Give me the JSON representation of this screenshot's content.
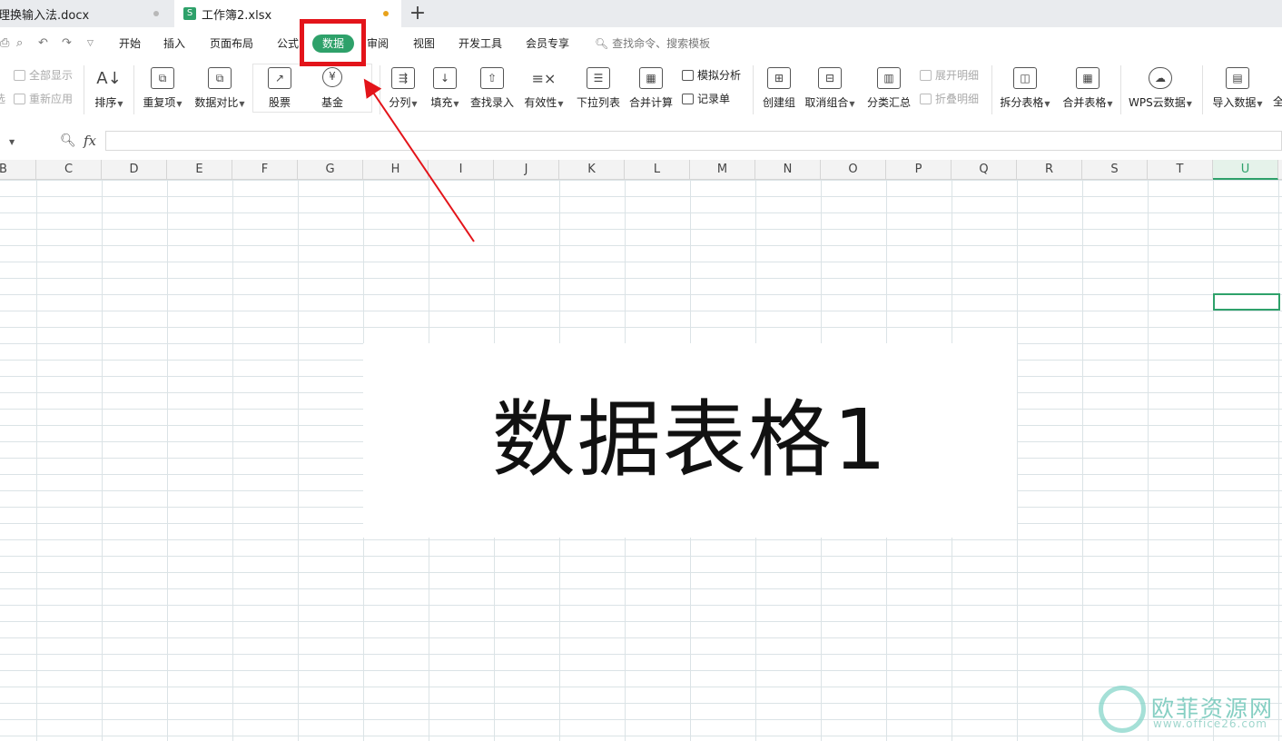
{
  "tabs": [
    {
      "title": "理换输入法.docx"
    },
    {
      "title": "工作簿2.xlsx",
      "logo": "S"
    }
  ],
  "new_tab": "+",
  "menu": {
    "items": [
      "开始",
      "插入",
      "页面布局",
      "公式",
      "数据",
      "审阅",
      "视图",
      "开发工具",
      "会员专享"
    ],
    "active": "数据",
    "search": "查找命令、搜索模板"
  },
  "ribbon": {
    "show_all": "全部显示",
    "reapply": "重新应用",
    "filter_cut": "选",
    "sort": "排序",
    "duplicates": "重复项",
    "compare": "数据对比",
    "stock": "股票",
    "fund": "基金",
    "fund_symbol": "¥",
    "split_col": "分列",
    "fill": "填充",
    "lookup": "查找录入",
    "validity": "有效性",
    "dropdown_list": "下拉列表",
    "consolidate": "合并计算",
    "simulation": "模拟分析",
    "record_sheet": "记录单",
    "create_group": "创建组",
    "ungroup": "取消组合",
    "subtotal": "分类汇总",
    "expand_detail": "展开明细",
    "collapse_detail": "折叠明细",
    "split_table": "拆分表格",
    "merge_table": "合并表格",
    "wps_cloud": "WPS云数据",
    "import_data": "导入数据",
    "more": "全"
  },
  "formula_bar": {
    "fx": "fx",
    "value": ""
  },
  "columns": [
    "B",
    "C",
    "D",
    "E",
    "F",
    "G",
    "H",
    "I",
    "J",
    "K",
    "L",
    "M",
    "N",
    "O",
    "P",
    "Q",
    "R",
    "S",
    "T",
    "U"
  ],
  "active_column": "U",
  "overlay_text": "数据表格1",
  "watermark": {
    "name": "欧菲资源网",
    "url": "www.office26.com"
  },
  "colors": {
    "accent": "#2ea16a",
    "annotation": "#e3141a",
    "watermark": "#86cfc3"
  }
}
